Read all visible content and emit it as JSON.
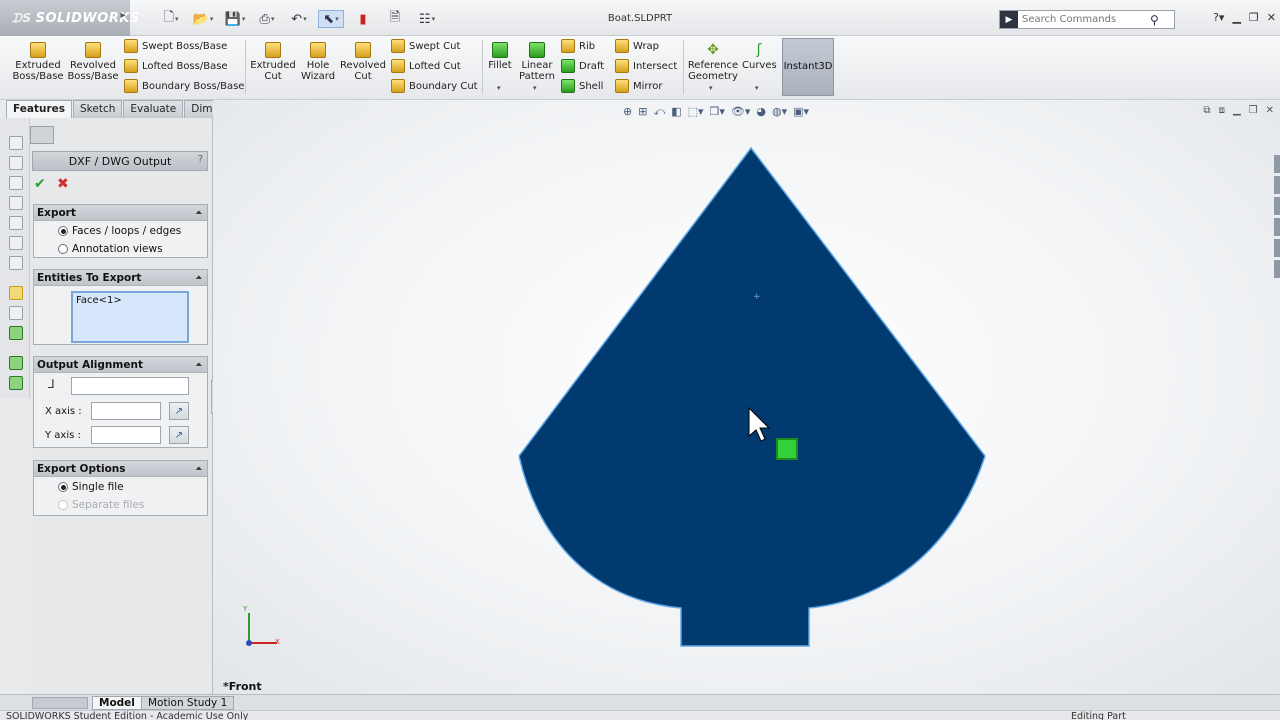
{
  "app": {
    "brand": "SOLIDWORKS",
    "doc_title": "Boat.SLDPRT"
  },
  "search": {
    "placeholder": "Search Commands"
  },
  "ribbon": {
    "extruded_boss": "Extruded Boss/Base",
    "revolved_boss": "Revolved Boss/Base",
    "swept_boss": "Swept Boss/Base",
    "lofted_boss": "Lofted Boss/Base",
    "boundary_boss": "Boundary Boss/Base",
    "extruded_cut": "Extruded Cut",
    "hole_wizard": "Hole Wizard",
    "revolved_cut": "Revolved Cut",
    "swept_cut": "Swept Cut",
    "lofted_cut": "Lofted Cut",
    "boundary_cut": "Boundary Cut",
    "fillet": "Fillet",
    "linear_pattern": "Linear Pattern",
    "rib": "Rib",
    "draft": "Draft",
    "shell": "Shell",
    "wrap": "Wrap",
    "intersect": "Intersect",
    "mirror": "Mirror",
    "reference_geometry": "Reference Geometry",
    "curves": "Curves",
    "instant3d": "Instant3D"
  },
  "tabs": [
    "Features",
    "Sketch",
    "Evaluate",
    "DimXpert"
  ],
  "property_manager": {
    "title": "DXF / DWG Output",
    "help": "?",
    "export": {
      "heading": "Export",
      "options": [
        "Faces / loops / edges",
        "Annotation views"
      ],
      "selected": 0
    },
    "entities": {
      "heading": "Entities To Export",
      "items": [
        "Face<1>"
      ]
    },
    "alignment": {
      "heading": "Output Alignment",
      "x_label": "X axis :",
      "y_label": "Y axis :",
      "origin_value": "",
      "x_value": "",
      "y_value": ""
    },
    "export_options": {
      "heading": "Export Options",
      "options": [
        "Single file",
        "Separate files"
      ],
      "selected": 0
    }
  },
  "viewport": {
    "view_name": "*Front",
    "part_color": "#003a6e",
    "outline_color": "#5fa8e8",
    "triad_x": "X",
    "triad_y": "Y"
  },
  "bottom_tabs": [
    "Model",
    "Motion Study 1"
  ],
  "status": {
    "left": "SOLIDWORKS Student Edition - Academic Use Only",
    "right": "Editing Part"
  }
}
